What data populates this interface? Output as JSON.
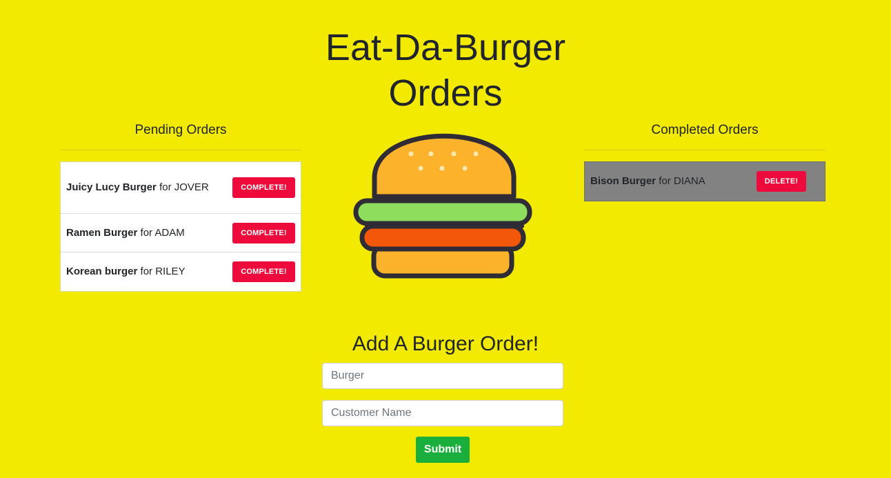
{
  "header": {
    "title_line1": "Eat-Da-Burger",
    "title_line2": "Orders"
  },
  "pending": {
    "heading": "Pending Orders",
    "items": [
      {
        "burger": "Juicy Lucy Burger",
        "for": "for",
        "customer": "JOVER",
        "button": "COMPLETE!"
      },
      {
        "burger": "Ramen Burger",
        "for": "for",
        "customer": "ADAM",
        "button": "COMPLETE!"
      },
      {
        "burger": "Korean burger",
        "for": "for",
        "customer": "RILEY",
        "button": "COMPLETE!"
      }
    ]
  },
  "completed": {
    "heading": "Completed Orders",
    "items": [
      {
        "burger": "Bison Burger",
        "for": "for",
        "customer": "DIANA",
        "button": "DELETE!"
      }
    ]
  },
  "form": {
    "heading": "Add A Burger Order!",
    "burger_placeholder": "Burger",
    "customer_placeholder": "Customer Name",
    "submit_label": "Submit"
  },
  "colors": {
    "background": "#f2ea00",
    "action_red": "#ee0b3c",
    "submit_green": "#1aae3c",
    "completed_row": "#828282"
  },
  "icons": {
    "hero": "burger-icon"
  }
}
